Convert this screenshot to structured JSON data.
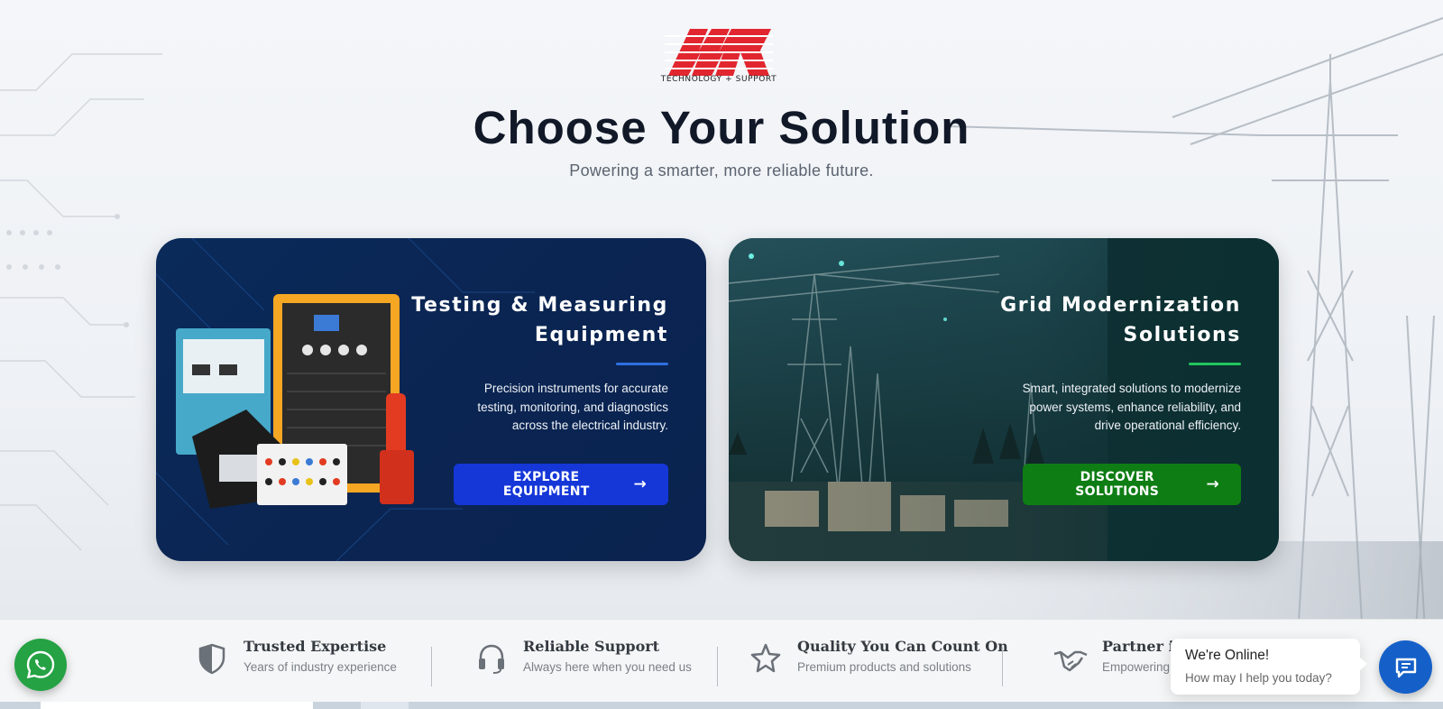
{
  "header": {
    "logo_tag": "TECHNOLOGY + SUPPORT",
    "title": "Choose Your Solution",
    "subtitle": "Powering a smarter, more reliable future."
  },
  "cards": [
    {
      "title_line1": "Testing & Measuring",
      "title_line2": "Equipment",
      "description": "Precision instruments for accurate testing, monitoring, and diagnostics across the electrical industry.",
      "button_label": "EXPLORE EQUIPMENT",
      "button_icon": "arrow-right-icon",
      "accent_color": "#2f6fe0",
      "button_color": "#1537d8"
    },
    {
      "title_line1": "Grid Modernization",
      "title_line2": "Solutions",
      "description": "Smart, integrated solutions to modernize power systems, enhance reliability, and drive operational efficiency.",
      "button_label": "DISCOVER SOLUTIONS",
      "button_icon": "arrow-right-icon",
      "accent_color": "#22c55e",
      "button_color": "#0e7d14"
    }
  ],
  "features": [
    {
      "icon": "shield-icon",
      "title": "Trusted Expertise",
      "subtitle": "Years of industry experience"
    },
    {
      "icon": "headset-icon",
      "title": "Reliable Support",
      "subtitle": "Always here when you need us"
    },
    {
      "icon": "star-icon",
      "title": "Quality You Can Count On",
      "subtitle": "Premium products and solutions"
    },
    {
      "icon": "handshake-icon",
      "title": "Partner in",
      "subtitle": "Empowering"
    }
  ],
  "chat": {
    "title": "We're Online!",
    "subtitle": "How may I help you today?"
  },
  "colors": {
    "brand_red": "#e2262f",
    "title_dark": "#111827",
    "whatsapp_green": "#25a244",
    "chat_blue": "#1560c8"
  }
}
